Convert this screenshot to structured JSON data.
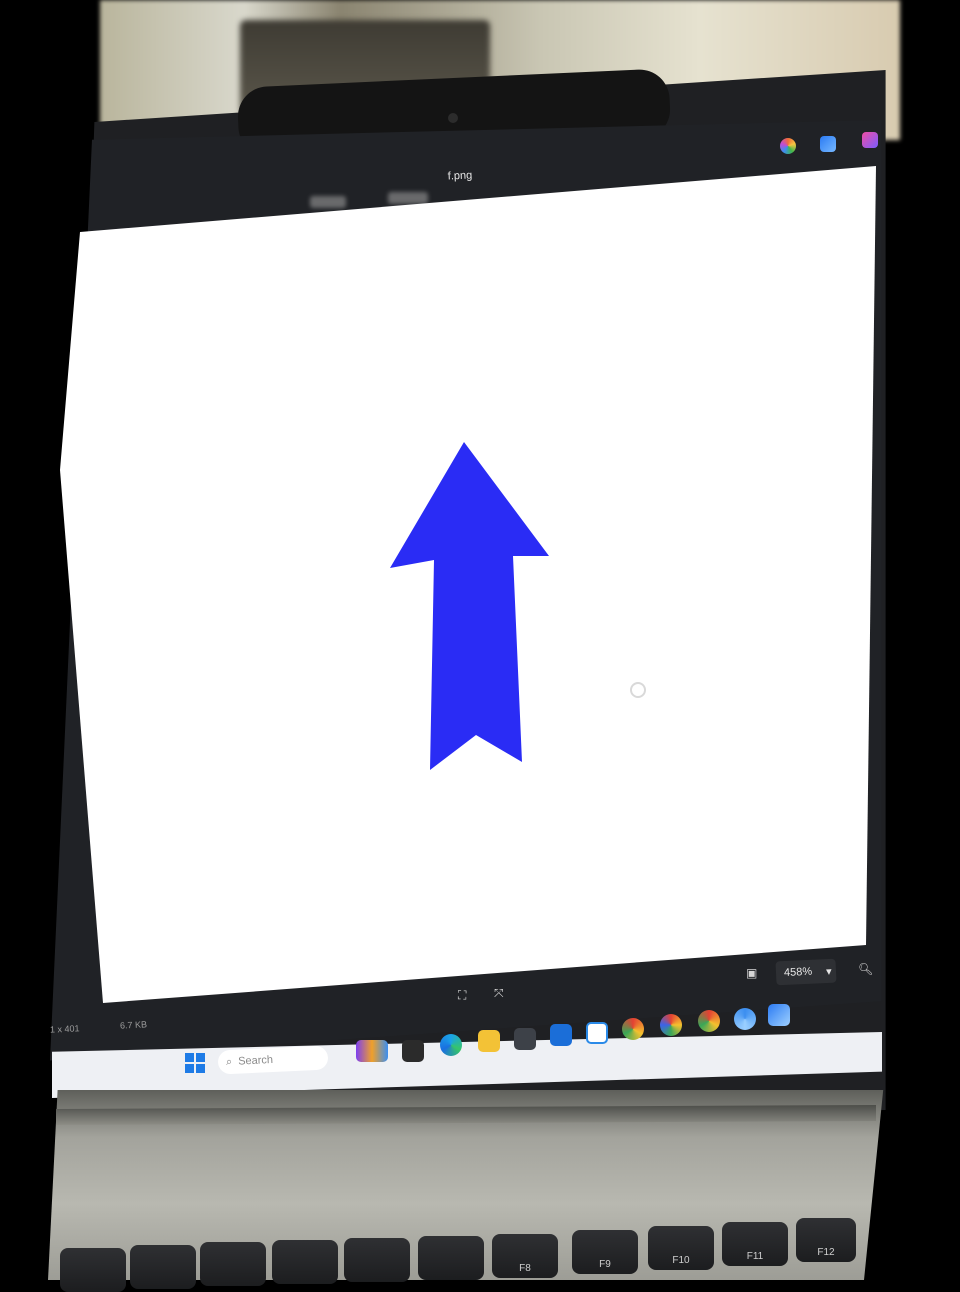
{
  "viewer": {
    "file_name": "f.png",
    "zoom_level": "458%",
    "image_dimensions": "1 x 401",
    "file_size": "6.7 KB"
  },
  "image": {
    "subject": "blue arrow pointing up",
    "arrow_color": "#2a2cf5",
    "background_color": "#ffffff"
  },
  "taskbar": {
    "search_placeholder": "Search",
    "apps": [
      "widgets-icon",
      "file-manager-icon",
      "edge-icon",
      "folder-icon",
      "photos-icon",
      "mail-icon",
      "vscode-icon",
      "chrome-icon",
      "chrome-profile-icon",
      "chrome-profile-icon",
      "chrome-profile-icon",
      "photo-viewer-icon"
    ]
  },
  "keyboard": {
    "keys": [
      "",
      "",
      "",
      "",
      "",
      "",
      "F8",
      "F9",
      "F10",
      "F11",
      "F12"
    ]
  },
  "colors": {
    "bezel": "#1f2023",
    "taskbar": "#eef0f4",
    "accent": "#2a2cf5"
  }
}
